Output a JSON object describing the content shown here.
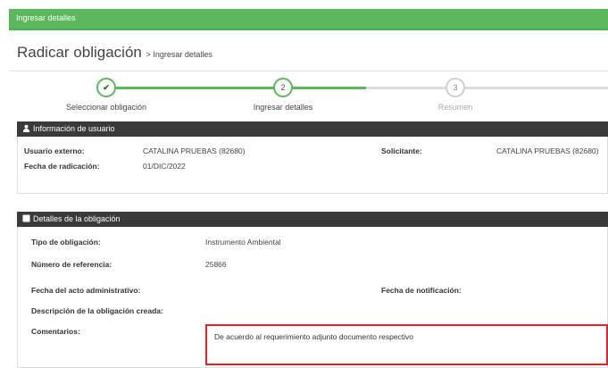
{
  "header": {
    "title": "Ingresar detalles"
  },
  "page": {
    "title": "Radicar obligación",
    "breadcrumb": "> Ingresar detalles"
  },
  "steps": [
    {
      "label": "Seleccionar obligación",
      "marker": "✔",
      "state": "done"
    },
    {
      "label": "Ingresar detalles",
      "marker": "2",
      "state": "current"
    },
    {
      "label": "Resumen",
      "marker": "3",
      "state": "pending"
    }
  ],
  "user_panel": {
    "title": "Información de usuario",
    "external_user_label": "Usuario externo:",
    "external_user_value": "CATALINA PRUEBAS (82680)",
    "requester_label": "Solicitante:",
    "requester_value": "CATALINA PRUEBAS (82680)",
    "date_label": "Fecha de radicación:",
    "date_value": "01/DIC/2022"
  },
  "details_panel": {
    "title": "Detalles de la obligación",
    "type_label": "Tipo de obligación:",
    "type_value": "Instrumento Ambiental",
    "ref_label": "Número de referencia:",
    "ref_value": "25866",
    "admin_date_label": "Fecha del acto administrativo:",
    "notif_date_label": "Fecha de notificación:",
    "desc_label": "Descripción de la obligación creada:",
    "comments_label": "Comentarios:",
    "comments_value": "De acuerdo al requerimiento adjunto documento respectivo"
  },
  "colors": {
    "green": "#5cb85c",
    "dark": "#3a3a3a",
    "highlight": "#e8202a"
  }
}
